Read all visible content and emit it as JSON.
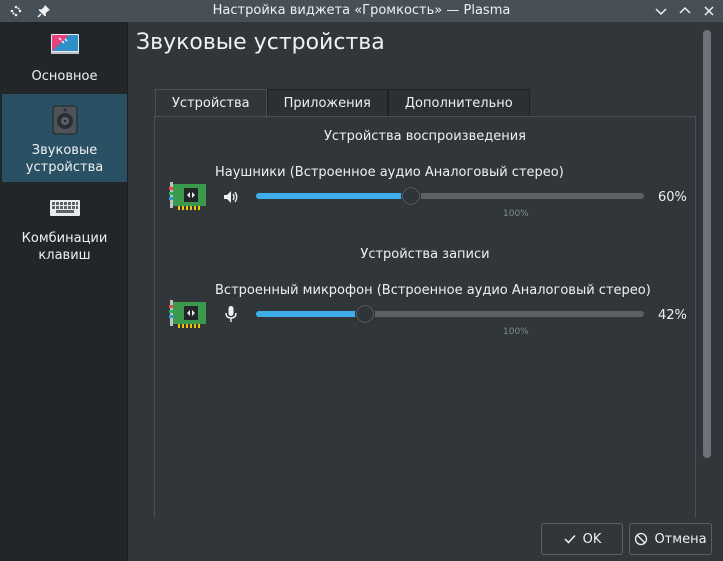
{
  "window": {
    "title": "Настройка виджета «Громкость» — Plasma",
    "menu_icon": "kde-menu-icon",
    "pin_icon": "pin-icon",
    "collapse_icon": "chevron-down-icon",
    "expand_icon": "chevron-up-icon",
    "close_icon": "close-icon"
  },
  "sidebar": {
    "items": [
      {
        "label": "Основное",
        "icon": "general-settings-icon"
      },
      {
        "label": "Звуковые устройства",
        "icon": "speaker-device-icon",
        "active": true
      },
      {
        "label": "Комбинации клавиш",
        "icon": "keyboard-icon"
      }
    ]
  },
  "page": {
    "title": "Звуковые устройства"
  },
  "tabs": [
    {
      "label": "Устройства",
      "active": true
    },
    {
      "label": "Приложения"
    },
    {
      "label": "Дополнительно"
    }
  ],
  "playback": {
    "section_title": "Устройства воспроизведения",
    "device_name": "Наушники (Встроенное аудио Аналоговый стерео)",
    "volume_percent": 60,
    "volume_label": "60%",
    "tick_label": "100%",
    "icon": "speaker-volume-icon"
  },
  "capture": {
    "section_title": "Устройства записи",
    "device_name": "Встроенный микрофон (Встроенное аудио Аналоговый стерео)",
    "volume_percent": 42,
    "volume_label": "42%",
    "tick_label": "100%",
    "icon": "microphone-icon"
  },
  "buttons": {
    "ok_label": "OK",
    "cancel_label": "Отмена"
  },
  "colors": {
    "accent": "#3daee9",
    "sidebar_active": "#2a5064",
    "background": "#31363b"
  }
}
